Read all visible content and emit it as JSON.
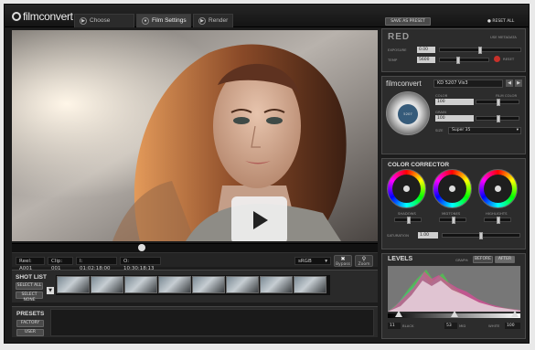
{
  "app": {
    "name": "filmconvert"
  },
  "tabs": [
    {
      "label": "Choose Footage",
      "icon": "folder-icon"
    },
    {
      "label": "Film Settings",
      "icon": "film-icon",
      "active": true
    },
    {
      "label": "Render",
      "icon": "render-icon"
    }
  ],
  "timecode": {
    "reel_label": "Reel:",
    "reel": "A001",
    "clip_label": "Clip:",
    "clip": "001",
    "in_label": "I:",
    "in_tc": "01:02:18:00",
    "out_label": "O:",
    "out_tc": "10:30:18:13",
    "codec": "sRGB",
    "bypass": "Bypass",
    "zoom": "Zoom"
  },
  "shotlist": {
    "title": "SHOT LIST",
    "select_all": "SELECT ALL",
    "select_none": "SELECT NONE"
  },
  "presets": {
    "title": "PRESETS",
    "factory": "FACTORY",
    "user": "USER"
  },
  "right": {
    "save_preset": "SAVE AS PRESET",
    "reset_all": "RESET ALL"
  },
  "red": {
    "logo": "RED",
    "use_metadata": "USE METADATA",
    "exposure_label": "EXPOSURE",
    "exposure": "0.00",
    "temp_label": "TEMP",
    "temp": "5600",
    "reset": "RESET"
  },
  "film": {
    "logo": "filmconvert",
    "stock": "KD 5207 Vis3",
    "color_label": "COLOR",
    "color": "100",
    "grain_label": "GRAIN",
    "grain": "100",
    "film_color_label": "FILM COLOR",
    "size_label": "SIZE",
    "size": "Super 35",
    "badge": "5207"
  },
  "cc": {
    "title": "COLOR CORRECTOR",
    "shadows": "SHADOWS",
    "midtones": "MIDTONES",
    "highlights": "HIGHLIGHTS",
    "saturation_label": "SATURATION",
    "saturation": "1.00"
  },
  "levels": {
    "title": "LEVELS",
    "graph_label": "GRAPH:",
    "before": "BEFORE",
    "after": "AFTER",
    "black_value": "11",
    "black_label": "BLACK",
    "mid_value": "53",
    "mid_label": "MID",
    "white_label": "WHITE",
    "white_value": "100"
  }
}
